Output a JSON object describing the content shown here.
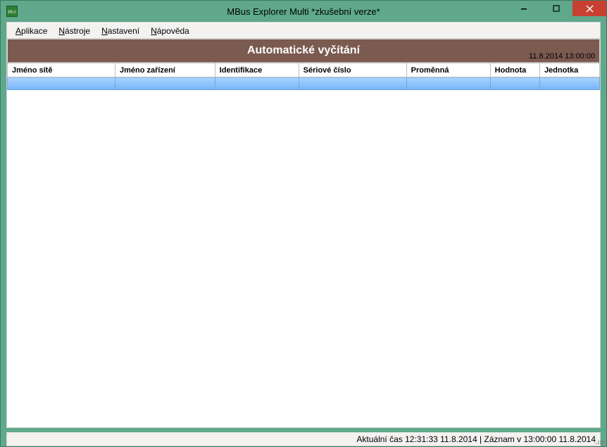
{
  "window": {
    "title": "MBus Explorer Multi *zkušební verze*"
  },
  "menu": {
    "items": [
      {
        "prefix": "A",
        "rest": "plikace"
      },
      {
        "prefix": "N",
        "rest": "ástroje"
      },
      {
        "prefix": "N",
        "rest": "astavení"
      },
      {
        "prefix": "N",
        "rest": "ápověda"
      }
    ]
  },
  "banner": {
    "title": "Automatické vyčítání",
    "timestamp": "11.8.2014 13:00:00"
  },
  "table": {
    "columns": [
      "Jméno sítě",
      "Jméno zařízení",
      "Identifikace",
      "Sériové číslo",
      "Proměnná",
      "Hodnota",
      "Jednotka"
    ],
    "rows": [
      {
        "cells": [
          "",
          "",
          "",
          "",
          "",
          "",
          ""
        ]
      }
    ]
  },
  "status": {
    "text": "Aktuální čas 12:31:33 11.8.2014 | Záznam v 13:00:00 11.8.2014"
  }
}
